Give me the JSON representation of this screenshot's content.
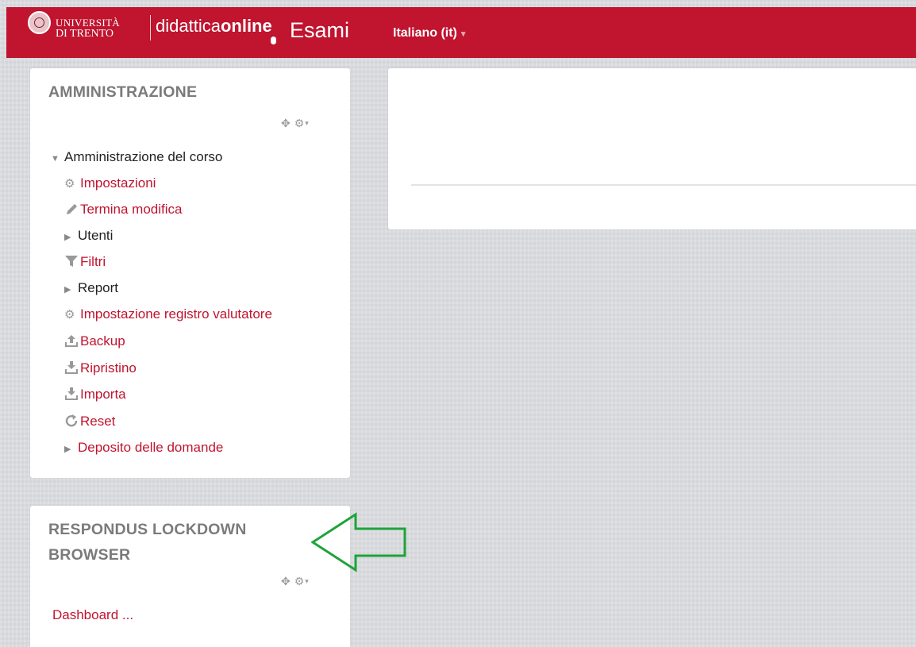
{
  "navbar": {
    "university_line1": "UNIVERSITÀ",
    "university_line2": "DI TRENTO",
    "brand_regular": "didattica",
    "brand_bold": "online",
    "site_name": "Esami",
    "language": "Italiano (it)",
    "language_caret": "▾"
  },
  "admin_block": {
    "title": "AMMINISTRAZIONE",
    "controls": {
      "move": "✥",
      "gear": "⚙",
      "caret": "▾"
    },
    "items": [
      {
        "label": "Amministrazione del corso",
        "icon": "triangle-down"
      },
      {
        "label": "Impostazioni",
        "icon": "gear-icon"
      },
      {
        "label": "Termina modifica",
        "icon": "pencil-icon"
      },
      {
        "label": "Utenti",
        "icon": "triangle-right"
      },
      {
        "label": "Filtri",
        "icon": "filter-icon"
      },
      {
        "label": "Report",
        "icon": "triangle-right"
      },
      {
        "label": "Impostazione registro valutatore",
        "icon": "gear-icon"
      },
      {
        "label": "Backup",
        "icon": "upload-icon"
      },
      {
        "label": "Ripristino",
        "icon": "download-icon"
      },
      {
        "label": "Importa",
        "icon": "download-icon"
      },
      {
        "label": "Reset",
        "icon": "refresh-icon"
      },
      {
        "label": "Deposito delle domande",
        "icon": "triangle-right"
      }
    ]
  },
  "respondus_block": {
    "title_line1": "RESPONDUS LOCKDOWN",
    "title_line2": "BROWSER",
    "controls": {
      "move": "✥",
      "gear": "⚙",
      "caret": "▾"
    },
    "dashboard_link": "Dashboard ..."
  },
  "annotation": {
    "arrow_color": "#1fa33b"
  },
  "colors": {
    "brand": "#c0142f",
    "link": "#c0142f",
    "block_title": "#7b7b7b"
  }
}
